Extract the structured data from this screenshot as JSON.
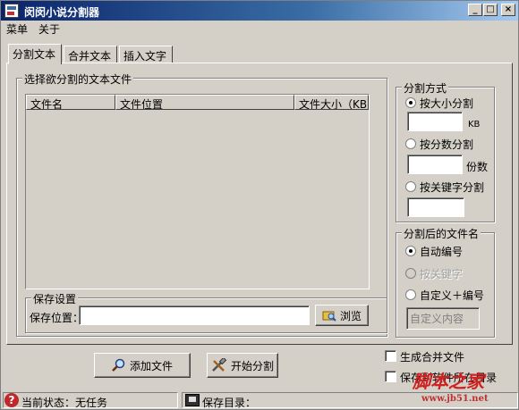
{
  "window": {
    "title": "闵闵小说分割器",
    "min": "_",
    "max": "□",
    "close": "×"
  },
  "menu": [
    "菜单",
    "关于"
  ],
  "tabs": [
    "分割文本",
    "合并文本",
    "插入文字"
  ],
  "select_group": {
    "legend": "选择欲分割的文本文件",
    "columns": [
      "文件名",
      "文件位置",
      "文件大小（KB）"
    ]
  },
  "split_mode": {
    "legend": "分割方式",
    "options": [
      {
        "label": "按大小分割",
        "unit": "KB",
        "checked": true
      },
      {
        "label": "按分数分割",
        "unit": "份数",
        "checked": false
      },
      {
        "label": "按关键字分割",
        "unit": "",
        "checked": false
      }
    ]
  },
  "filename_mode": {
    "legend": "分割后的文件名",
    "options": [
      {
        "label": "自动编号",
        "checked": true,
        "disabled": false
      },
      {
        "label": "按关键字",
        "checked": false,
        "disabled": true
      },
      {
        "label": "自定义＋编号",
        "checked": false,
        "disabled": false
      }
    ],
    "custom_placeholder": "自定义内容"
  },
  "save": {
    "legend": "保存设置",
    "label": "保存位置：",
    "value": "",
    "browse": "浏览"
  },
  "buttons": {
    "add": "添加文件",
    "start": "开始分割"
  },
  "checks": {
    "merge": "生成合并文件",
    "save_same": "保存到软件所在目录"
  },
  "status": {
    "state_label": "当前状态：",
    "state_value": "无任务",
    "dir_label": "保存目录："
  },
  "watermark": {
    "line1": "脚本之家",
    "line2": "www.jb51.net"
  }
}
